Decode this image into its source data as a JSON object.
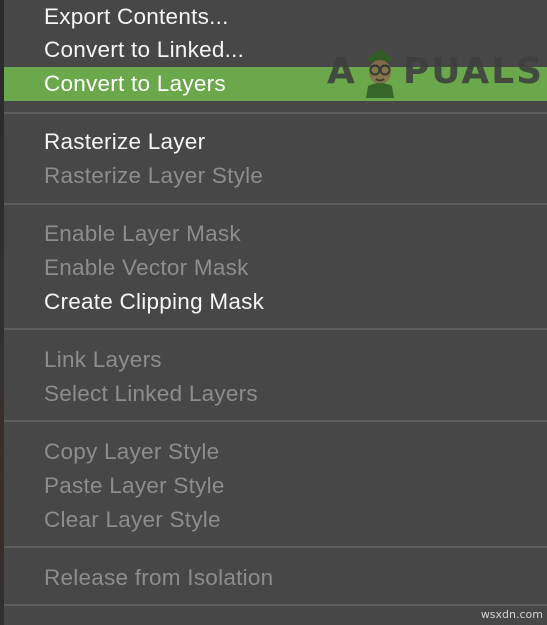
{
  "menu": {
    "items": [
      {
        "label": "Export Contents...",
        "enabled": true
      },
      {
        "label": "Convert to Linked...",
        "enabled": true
      },
      {
        "label": "Convert to Layers",
        "enabled": true,
        "highlighted": true
      },
      {
        "label": "Rasterize Layer",
        "enabled": true
      },
      {
        "label": "Rasterize Layer Style",
        "enabled": false
      },
      {
        "label": "Enable Layer Mask",
        "enabled": false
      },
      {
        "label": "Enable Vector Mask",
        "enabled": false
      },
      {
        "label": "Create Clipping Mask",
        "enabled": true
      },
      {
        "label": "Link Layers",
        "enabled": false
      },
      {
        "label": "Select Linked Layers",
        "enabled": false
      },
      {
        "label": "Copy Layer Style",
        "enabled": false
      },
      {
        "label": "Paste Layer Style",
        "enabled": false
      },
      {
        "label": "Clear Layer Style",
        "enabled": false
      },
      {
        "label": "Release from Isolation",
        "enabled": false
      }
    ]
  },
  "watermark": {
    "logo_prefix": "A",
    "logo_suffix": "PUALS",
    "credit": "wsxdn.com"
  },
  "colors": {
    "menu_background": "#474747",
    "highlight": "#6aa84b",
    "enabled_text": "#f5f5f5",
    "disabled_text": "#8d8d8d",
    "separator": "#5d5d5d"
  }
}
